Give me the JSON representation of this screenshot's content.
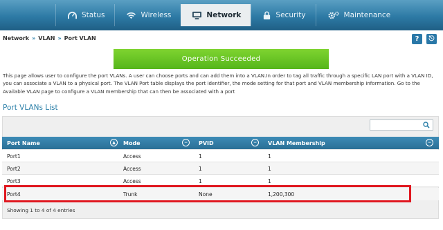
{
  "nav": {
    "items": [
      {
        "label": "Status",
        "icon": "gauge-icon"
      },
      {
        "label": "Wireless",
        "icon": "wifi-icon"
      },
      {
        "label": "Network",
        "icon": "monitor-icon",
        "active": true
      },
      {
        "label": "Security",
        "icon": "lock-icon"
      },
      {
        "label": "Maintenance",
        "icon": "gear-icon"
      }
    ]
  },
  "breadcrumb": [
    "Network",
    "VLAN",
    "Port VLAN"
  ],
  "breadcrumb_sep": "»",
  "help_label": "?",
  "logout_label": "⎋",
  "banner": "Operation Succeeded",
  "description": "This page allows user to configure the port VLANs. A user can choose ports and can add them into a VLAN.In order to tag all traffic through a specific LAN port with a VLAN ID, you can associate a VLAN to a physical port. The VLAN Port table displays the port identifier, the mode setting for that port and VLAN membership information. Go to the Available VLAN page to configure a VLAN membership that can then be associated with a port",
  "section_title": "Port VLANs List",
  "search": {
    "value": "",
    "placeholder": ""
  },
  "table": {
    "columns": [
      "Port Name",
      "Mode",
      "PVID",
      "VLAN Membership"
    ],
    "rows": [
      [
        "Port1",
        "Access",
        "1",
        "1"
      ],
      [
        "Port2",
        "Access",
        "1",
        "1"
      ],
      [
        "Port3",
        "Access",
        "1",
        "1"
      ],
      [
        "Port4",
        "Trunk",
        "None",
        "1,200,300"
      ]
    ]
  },
  "footer": "Showing 1 to 4 of 4 entries",
  "colors": {
    "nav_bg": "#2b6f95",
    "accent": "#2b7fa8",
    "success": "#5ebd22",
    "highlight": "#e0171f"
  }
}
